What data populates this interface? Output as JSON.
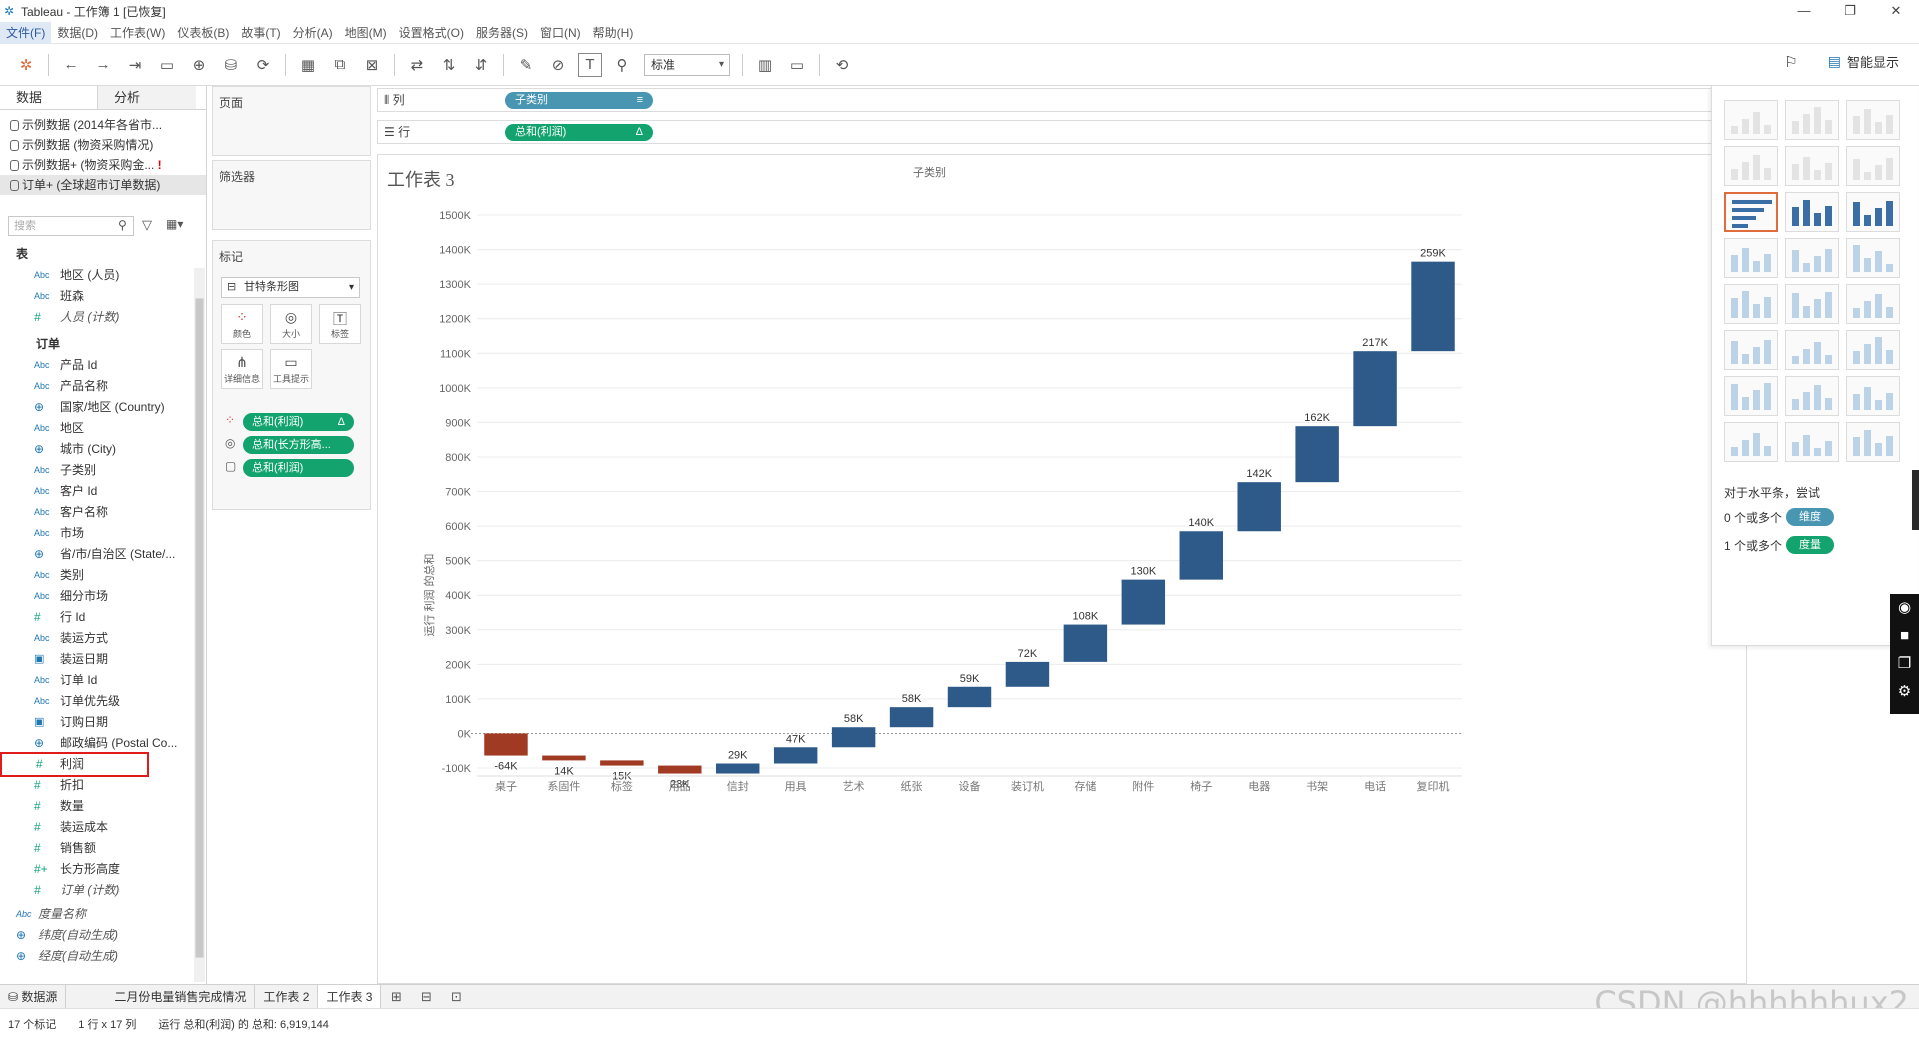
{
  "window": {
    "title": "Tableau - 工作簿 1 [已恢复]"
  },
  "menu": [
    "文件(F)",
    "数据(D)",
    "工作表(W)",
    "仪表板(B)",
    "故事(T)",
    "分析(A)",
    "地图(M)",
    "设置格式(O)",
    "服务器(S)",
    "窗口(N)",
    "帮助(H)"
  ],
  "toolbar": {
    "fit_dropdown": "标准",
    "smart_show": "智能显示"
  },
  "left_pane": {
    "tabs": [
      "数据",
      "分析"
    ],
    "datasources": [
      {
        "label": "示例数据 (2014年各省市...",
        "warn": ""
      },
      {
        "label": "示例数据 (物资采购情况)",
        "warn": ""
      },
      {
        "label": "示例数据+ (物资采购金...",
        "warn": "!"
      },
      {
        "label": "订单+ (全球超市订单数据)",
        "warn": ""
      }
    ],
    "search_placeholder": "搜索",
    "table_header": "表",
    "people_fields": [
      {
        "type": "Abc",
        "label": "地区 (人员)"
      },
      {
        "type": "Abc",
        "label": "班森"
      },
      {
        "type": "#",
        "label": "人员 (计数)",
        "italic": true
      }
    ],
    "order_table": "订单",
    "order_fields": [
      {
        "type": "Abc",
        "label": "产品 Id"
      },
      {
        "type": "Abc",
        "label": "产品名称"
      },
      {
        "type": "geo",
        "label": "国家/地区 (Country)"
      },
      {
        "type": "Abc",
        "label": "地区"
      },
      {
        "type": "geo",
        "label": "城市 (City)"
      },
      {
        "type": "Abc",
        "label": "子类别"
      },
      {
        "type": "Abc",
        "label": "客户 Id"
      },
      {
        "type": "Abc",
        "label": "客户名称"
      },
      {
        "type": "Abc",
        "label": "市场"
      },
      {
        "type": "geo",
        "label": "省/市/自治区 (State/..."
      },
      {
        "type": "Abc",
        "label": "类别"
      },
      {
        "type": "Abc",
        "label": "细分市场"
      },
      {
        "type": "#",
        "label": "行 Id"
      },
      {
        "type": "Abc",
        "label": "装运方式"
      },
      {
        "type": "date",
        "label": "装运日期"
      },
      {
        "type": "Abc",
        "label": "订单 Id"
      },
      {
        "type": "Abc",
        "label": "订单优先级"
      },
      {
        "type": "date",
        "label": "订购日期"
      },
      {
        "type": "geo",
        "label": "邮政编码 (Postal Co..."
      },
      {
        "type": "#",
        "label": "利润",
        "highlight": true
      },
      {
        "type": "#",
        "label": "折扣"
      },
      {
        "type": "#",
        "label": "数量"
      },
      {
        "type": "#",
        "label": "装运成本"
      },
      {
        "type": "#",
        "label": "销售额"
      },
      {
        "type": "#+",
        "label": "长方形高度"
      },
      {
        "type": "#",
        "label": "订单 (计数)",
        "italic": true
      }
    ],
    "extra_fields": [
      {
        "type": "Abc",
        "label": "度量名称",
        "italic": true
      },
      {
        "type": "geo",
        "label": "纬度(自动生成)",
        "italic": true
      },
      {
        "type": "geo",
        "label": "经度(自动生成)",
        "italic": true
      }
    ]
  },
  "cards": {
    "pages": "页面",
    "filters": "筛选器",
    "marks": "标记",
    "mark_type": "甘特条形图",
    "mark_buttons": [
      "颜色",
      "大小",
      "标签",
      "详细信息",
      "工具提示"
    ],
    "mark_pills": [
      "总和(利润)",
      "总和(长方形高...",
      "总和(利润)"
    ],
    "mark_pill_suffix": "Δ"
  },
  "shelves": {
    "columns_label": "列",
    "columns_pill": "子类别",
    "rows_label": "行",
    "rows_pill": "总和(利润)",
    "rows_pill_suffix": "Δ"
  },
  "sheet": {
    "title": "工作表 3"
  },
  "chart_data": {
    "type": "bar",
    "subtype": "waterfall-gantt",
    "title": "",
    "xlabel": "子类别",
    "ylabel": "运行 利润 的总和",
    "ylim": [
      -100000,
      1500000
    ],
    "yticks": [
      -100000,
      0,
      100000,
      200000,
      300000,
      400000,
      500000,
      600000,
      700000,
      800000,
      900000,
      1000000,
      1100000,
      1200000,
      1300000,
      1400000,
      1500000
    ],
    "ytick_labels": [
      "-100K",
      "0K",
      "100K",
      "200K",
      "300K",
      "400K",
      "500K",
      "600K",
      "700K",
      "800K",
      "900K",
      "1000K",
      "1100K",
      "1200K",
      "1300K",
      "1400K",
      "1500K"
    ],
    "categories": [
      "桌子",
      "系固件",
      "标签",
      "用品",
      "信封",
      "用具",
      "艺术",
      "纸张",
      "设备",
      "装订机",
      "存储",
      "附件",
      "椅子",
      "电器",
      "书架",
      "电话",
      "复印机"
    ],
    "start": [
      0,
      -64000,
      -78000,
      -93000,
      -116000,
      -87000,
      -40000,
      18000,
      76000,
      135000,
      207000,
      315000,
      445000,
      585000,
      727000,
      889000,
      1106000
    ],
    "end": [
      -64000,
      -78000,
      -93000,
      -116000,
      -87000,
      -40000,
      18000,
      76000,
      135000,
      207000,
      315000,
      445000,
      585000,
      727000,
      889000,
      1106000,
      1365000
    ],
    "labels": [
      "-64K",
      "14K",
      "15K",
      "23K",
      "29K",
      "47K",
      "58K",
      "58K",
      "59K",
      "72K",
      "108K",
      "130K",
      "140K",
      "142K",
      "162K",
      "217K",
      "259K"
    ],
    "colors": {
      "positive": "#2e5a8a",
      "negative": "#a13a22"
    },
    "grid": true
  },
  "show_me": {
    "hint": "对于水平条，尝试",
    "dim_req": "0 个或多个",
    "dim": "维度",
    "meas_req": "1 个或多个",
    "meas": "度量"
  },
  "bottom": {
    "datasource_tab": "数据源",
    "sheets": [
      "二月份电量销售完成情况",
      "工作表 2",
      "工作表 3"
    ]
  },
  "status": {
    "marks": "17 个标记",
    "dims": "1 行 x 17 列",
    "sum": "运行 总和(利润) 的 总和: 6,919,144"
  },
  "watermark": "CSDN @hhhhhhux2",
  "colors": {
    "dimension": "#4996b2",
    "measure": "#13a36e",
    "accent": "#e06c3d"
  }
}
